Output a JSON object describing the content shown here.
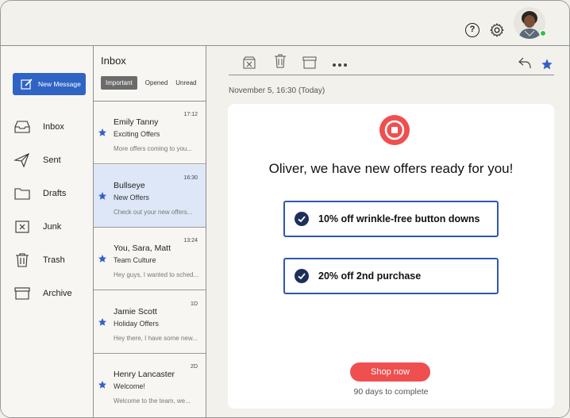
{
  "header": {
    "help_icon_glyph": "?",
    "icons": [
      "help-icon",
      "gear-icon",
      "avatar"
    ],
    "status_color": "#2ec24a"
  },
  "sidebar": {
    "new_message_label": "New Message",
    "accent": "#2f63c4",
    "items": [
      {
        "label": "Inbox",
        "icon": "inbox-icon"
      },
      {
        "label": "Sent",
        "icon": "send-icon"
      },
      {
        "label": "Drafts",
        "icon": "folder-icon"
      },
      {
        "label": "Junk",
        "icon": "junk-icon"
      },
      {
        "label": "Trash",
        "icon": "trash-icon"
      },
      {
        "label": "Archive",
        "icon": "archive-icon"
      }
    ]
  },
  "list": {
    "title": "Inbox",
    "filters": [
      "Important",
      "Opened",
      "Unread"
    ],
    "active_filter": "Important",
    "emails": [
      {
        "time": "17:12",
        "sender": "Emily Tanny",
        "subject": "Exciting Offers",
        "preview": "More offers coming to you...",
        "starred": true
      },
      {
        "time": "16:30",
        "sender": "Bullseye",
        "subject": "New Offers",
        "preview": "Check out your new offers...",
        "starred": true,
        "selected": true
      },
      {
        "time": "13:24",
        "sender": "You, Sara, Matt",
        "subject": "Team Culture",
        "preview": "Hey guys, I wanted to sched...",
        "starred": true
      },
      {
        "time": "1D",
        "sender": "Jamie Scott",
        "subject": "Holiday Offers",
        "preview": "Hey there, I have some new...",
        "starred": true
      },
      {
        "time": "2D",
        "sender": "Henry Lancaster",
        "subject": "Welcome!",
        "preview": "Welcome to the team, we...",
        "starred": true
      }
    ]
  },
  "main": {
    "toolbar": [
      "delete-x-icon",
      "trash-icon",
      "archive-icon",
      "more-icon",
      "reply-icon",
      "star-icon"
    ],
    "date": "November 5, 16:30 (Today)",
    "headline": "Oliver, we have new offers ready for you!",
    "offers": [
      "10% off wrinkle-free button downs",
      "20% off 2nd purchase"
    ],
    "cta_label": "Shop now",
    "cta_note": "90 days to complete",
    "brand_color": "#ef4f4f",
    "offer_border_color": "#2f56b0"
  }
}
